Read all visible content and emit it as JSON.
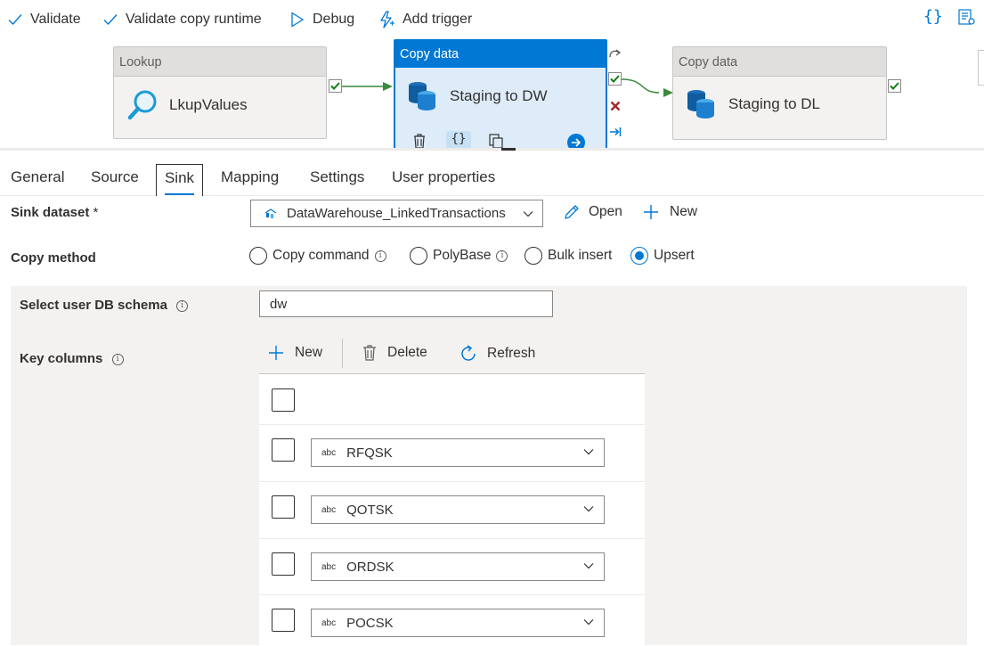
{
  "toolbar": {
    "validate": "Validate",
    "validate_runtime": "Validate copy runtime",
    "debug": "Debug",
    "add_trigger": "Add trigger"
  },
  "pipeline": {
    "nodes": [
      {
        "type": "Lookup",
        "name": "LkupValues"
      },
      {
        "type": "Copy data",
        "name": "Staging to DW"
      },
      {
        "type": "Copy data",
        "name": "Staging to DL"
      }
    ]
  },
  "tabs": [
    "General",
    "Source",
    "Sink",
    "Mapping",
    "Settings",
    "User properties"
  ],
  "active_tab": "Sink",
  "sink": {
    "dataset_label": "Sink dataset",
    "required_mark": "*",
    "dataset_value": "DataWarehouse_LinkedTransactions",
    "open": "Open",
    "new": "New",
    "copy_method_label": "Copy method",
    "copy_methods": [
      "Copy command",
      "PolyBase",
      "Bulk insert",
      "Upsert"
    ],
    "selected_copy_method": "Upsert",
    "schema_label": "Select user DB schema",
    "schema_value": "dw",
    "key_columns_label": "Key columns",
    "grid_actions": {
      "new": "New",
      "delete": "Delete",
      "refresh": "Refresh"
    },
    "type_badge": "abc",
    "key_columns": [
      "RFQSK",
      "QOTSK",
      "ORDSK",
      "POCSK"
    ]
  },
  "colors": {
    "accent": "#0078d4",
    "success": "#107c10",
    "fail": "#a4262c"
  },
  "info_glyph": "i"
}
